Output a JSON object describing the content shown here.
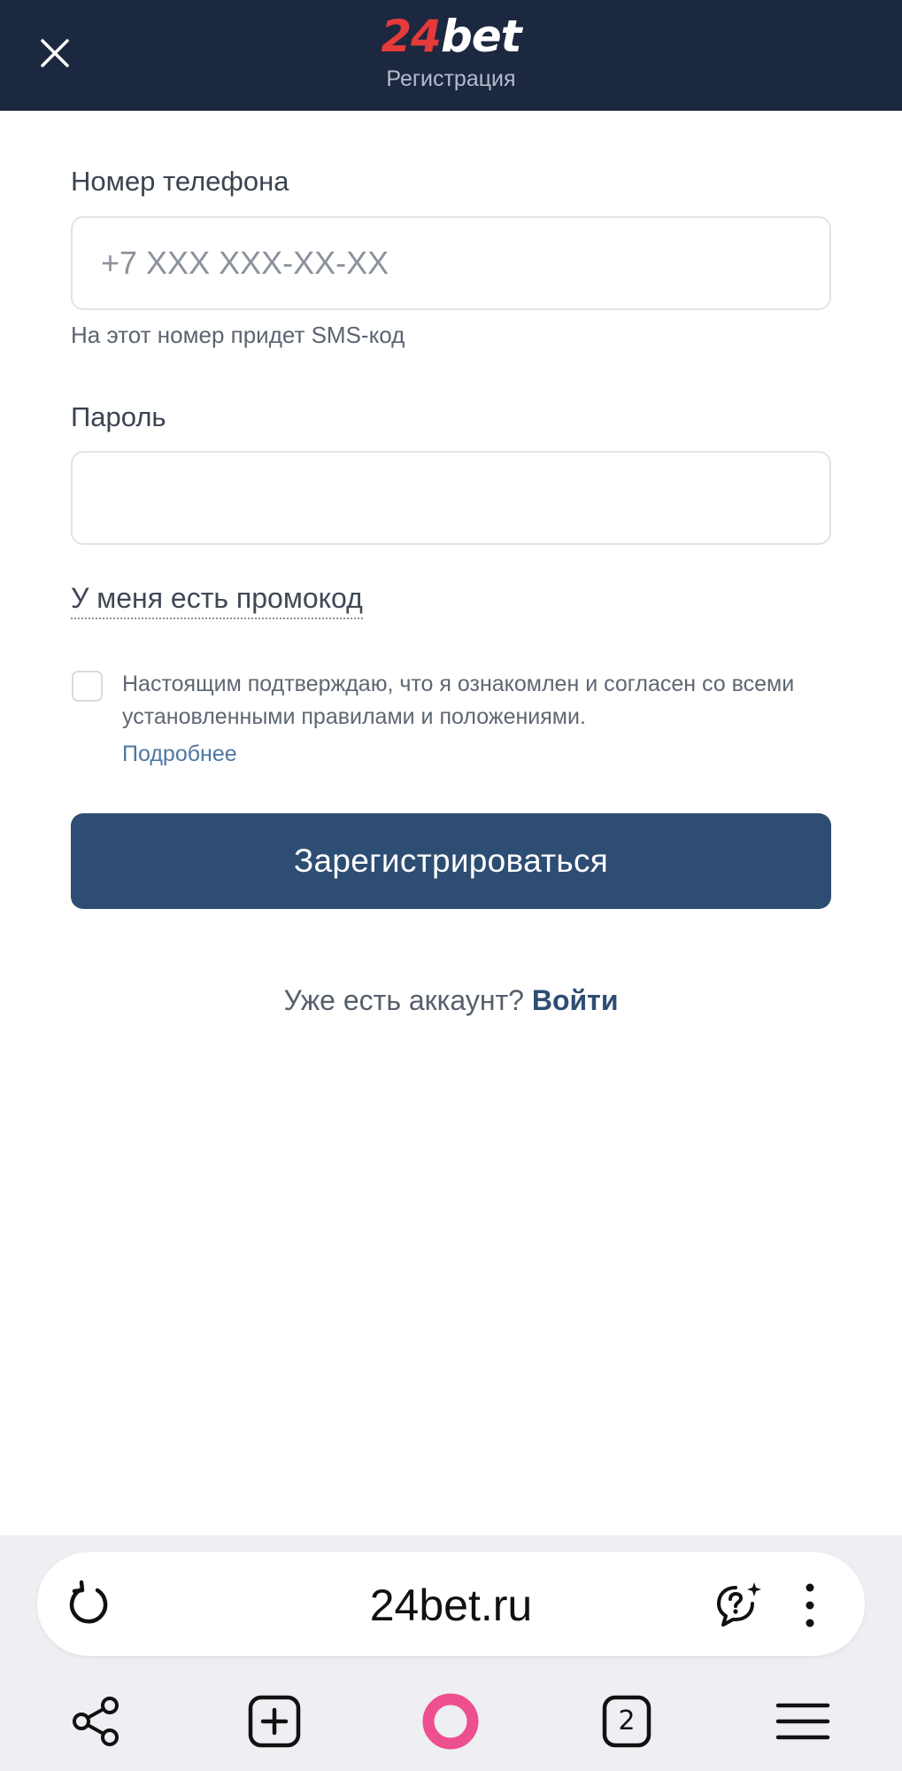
{
  "header": {
    "logo_num": "24",
    "logo_word": "bet",
    "subtitle": "Регистрация"
  },
  "form": {
    "phone_label": "Номер телефона",
    "phone_placeholder": "+7 XXX XXX-XX-XX",
    "phone_value": "",
    "phone_hint": "На этот номер придет SMS-код",
    "password_label": "Пароль",
    "password_value": "",
    "promo_link": "У меня есть промокод",
    "terms_checked": false,
    "terms_text": "Настоящим подтверждаю, что я ознакомлен и согласен со всеми установленными правилами и положениями.",
    "more_link": "Подробнее",
    "register_button": "Зарегистрироваться",
    "login_question": "Уже есть аккаунт?",
    "login_link": "Войти"
  },
  "browser": {
    "url": "24bet.ru",
    "tabs_count": "2"
  },
  "colors": {
    "header_bg": "#1c2840",
    "logo_accent": "#e53a3a",
    "primary_button": "#2e4d73",
    "link": "#4f77a3",
    "alice_ring": "#ee4f8e"
  },
  "icons": {
    "close": "close-icon",
    "reload": "reload-icon",
    "assistant": "ai-assistant-icon",
    "menu": "kebab-menu-icon",
    "share": "share-icon",
    "new_tab": "new-tab-icon",
    "alice": "alice-icon",
    "tabs": "tabs-icon",
    "hamburger": "hamburger-menu-icon"
  }
}
